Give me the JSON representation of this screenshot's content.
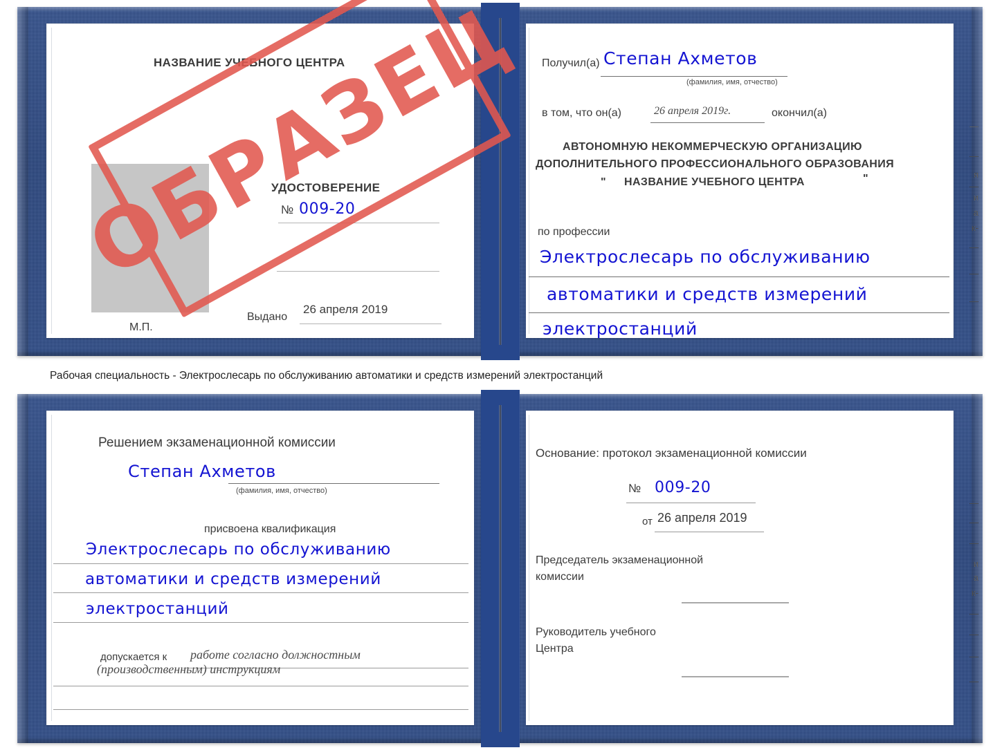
{
  "caption": "Рабочая специальность - Электрослесарь по обслуживанию автоматики и средств измерений электростанций",
  "watermark": {
    "text": "ОБРАЗЕЦ",
    "color": "#e2584f"
  },
  "colors": {
    "cover_blue": "#27478c",
    "ink_blue": "#1414d2",
    "stamp_red": "#e2584f",
    "photo_gray": "#c6c6c6"
  },
  "cert_top": {
    "left_page": {
      "center_name": "НАЗВАНИЕ УЧЕБНОГО ЦЕНТРА",
      "title": "УДОСТОВЕРЕНИЕ",
      "number_label": "№",
      "number_value": "009-20",
      "issued_label": "Выдано",
      "issued_value": "26 апреля 2019",
      "seal_label": "М.П."
    },
    "right_page": {
      "received_label": "Получил(а)",
      "received_value": "Степан Ахметов",
      "fio_hint": "(фамилия, имя, отчество)",
      "in_that_label": "в том, что он(а)",
      "in_that_value": "26 апреля 2019г.",
      "finished_label": "окончил(а)",
      "org_line1": "АВТОНОМНУЮ НЕКОММЕРЧЕСКУЮ ОРГАНИЗАЦИЮ",
      "org_line2": "ДОПОЛНИТЕЛЬНОГО ПРОФЕССИОНАЛЬНОГО ОБРАЗОВАНИЯ",
      "org_quote_open": "\"",
      "org_line3": "НАЗВАНИЕ УЧЕБНОГО ЦЕНТРА",
      "org_quote_close": "\"",
      "profession_label": "по профессии",
      "profession_line1": "Электрослесарь по обслуживанию",
      "profession_line2": "автоматики и средств измерений",
      "profession_line3": "электростанций",
      "edge_glyphs": [
        "—",
        "—",
        "я",
        "—",
        "и",
        "а",
        "к-",
        "—",
        "—",
        "—"
      ]
    }
  },
  "cert_bottom": {
    "left_page": {
      "decision_label": "Решением экзаменационной комиссии",
      "name_value": "Степан Ахметов",
      "fio_hint": "(фамилия, имя, отчество)",
      "qualification_label": "присвоена квалификация",
      "qualification_line1": "Электрослесарь по обслуживанию",
      "qualification_line2": "автоматики и средств измерений",
      "qualification_line3": "электростанций",
      "admitted_label": "допускается к",
      "admitted_line1": "работе согласно должностным",
      "admitted_line2": "(производственным) инструкциям"
    },
    "right_page": {
      "basis_label": "Основание: протокол экзаменационной комиссии",
      "number_label": "№",
      "number_value": "009-20",
      "from_label": "от",
      "from_value": "26 апреля 2019",
      "chairman_line1": "Председатель экзаменационной",
      "chairman_line2": "комиссии",
      "head_line1": "Руководитель учебного",
      "head_line2": "Центра",
      "edge_glyphs": [
        "—",
        "—",
        "—",
        "и",
        "а",
        "к-",
        "—",
        "—",
        "—",
        "—"
      ]
    }
  }
}
